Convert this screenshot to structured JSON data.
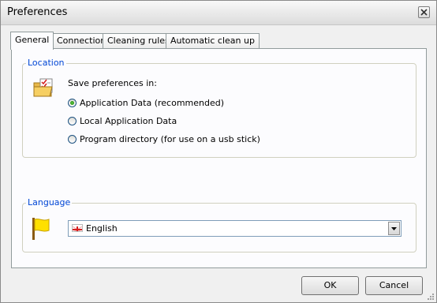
{
  "window": {
    "title": "Preferences"
  },
  "icons": {
    "close": "close-icon",
    "folder": "folder-checklist-icon",
    "flag": "yellow-flag-icon",
    "uk_flag": "uk-flag-icon",
    "dropdown": "chevron-down-icon"
  },
  "tabs": [
    {
      "label": "General",
      "active": true
    },
    {
      "label": "Connection",
      "active": false
    },
    {
      "label": "Cleaning rules",
      "active": false
    },
    {
      "label": "Automatic clean up",
      "active": false
    }
  ],
  "location": {
    "legend": "Location",
    "prompt": "Save preferences in:",
    "options": [
      {
        "label": "Application Data (recommended)",
        "checked": true
      },
      {
        "label": "Local Application Data",
        "checked": false
      },
      {
        "label": "Program directory (for use on a usb stick)",
        "checked": false
      }
    ]
  },
  "language": {
    "legend": "Language",
    "selected": "English"
  },
  "footer": {
    "ok_label": "OK",
    "cancel_label": "Cancel"
  },
  "colors": {
    "group_label": "#0046d5",
    "window_bg": "#f0f0f0",
    "panel_bg": "#fcfcfe"
  }
}
